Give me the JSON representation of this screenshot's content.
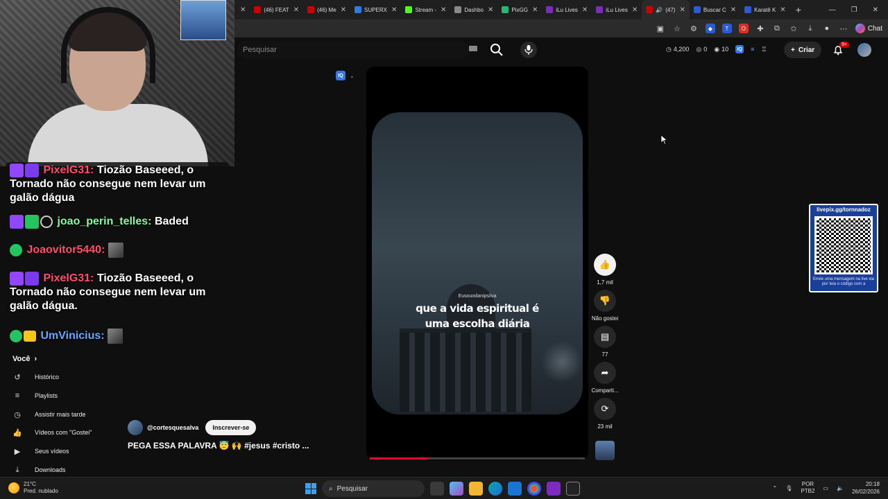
{
  "browser": {
    "tabs": [
      {
        "label": "(46) FEAT",
        "color": "#cc0000"
      },
      {
        "label": "(46) Me",
        "color": "#cc0000"
      },
      {
        "label": "SUPERX",
        "color": "#2a7de1"
      },
      {
        "label": "Stream -",
        "color": "#53fc18"
      },
      {
        "label": "Dashbo",
        "color": "#888888"
      },
      {
        "label": "PixGG",
        "color": "#2bb673"
      },
      {
        "label": "iLu Lives",
        "color": "#7b2cbf"
      },
      {
        "label": "iLu Lives",
        "color": "#7b2cbf"
      },
      {
        "label": "(47)",
        "color": "#cc0000"
      },
      {
        "label": "Buscar C",
        "color": "#2a5bd7"
      },
      {
        "label": "Karatê K",
        "color": "#2a5bd7"
      }
    ],
    "active_tab_index": 8,
    "toolbar_chat_label": "Chat"
  },
  "youtube": {
    "search_placeholder": "Pesquisar",
    "stats": {
      "viewers": "4,200",
      "eye_count": "0",
      "other_count": "10"
    },
    "create_label": "Criar",
    "notification_badge": "9+"
  },
  "chat": {
    "messages": [
      {
        "user": "PixelG31:",
        "text": " Tiozão Baseeed, o Tornado não consegue nem levar um galão dágua"
      },
      {
        "user": "joao_perin_telles:",
        "text": " Baded"
      },
      {
        "user": "Joaovitor5440:",
        "text": ""
      },
      {
        "user": "PixelG31:",
        "text": " Tiozão Baseeed, o Tornado não consegue nem levar um galão dágua."
      },
      {
        "user": "UmVinicius:",
        "text": ""
      }
    ]
  },
  "sidebar": {
    "section": "Você",
    "items": [
      {
        "label": "Histórico",
        "icon": "history-icon"
      },
      {
        "label": "Playlists",
        "icon": "playlist-icon"
      },
      {
        "label": "Assistir mais tarde",
        "icon": "clock-icon"
      },
      {
        "label": "Vídeos com \"Gostei\"",
        "icon": "thumbs-up-icon"
      },
      {
        "label": "Seus vídeos",
        "icon": "play-icon"
      },
      {
        "label": "Downloads",
        "icon": "download-icon"
      }
    ]
  },
  "short": {
    "watermark": "Eusouodanipsilva",
    "caption": "que a vida espiritual é uma escolha diária",
    "progress_fraction": 0.27,
    "actions": {
      "likes": "1,7 mil",
      "dislike_label": "Não gostei",
      "comments": "77",
      "share_label": "Comparti...",
      "remix_count": "23 mil"
    },
    "channel": "@cortesquesalva",
    "subscribe_label": "Inscrever-se",
    "title": "PEGA ESSA PALAVRA 😇 🙌 #jesus #cristo ..."
  },
  "qr": {
    "url": "livepix.gg/tornnadoz",
    "bottom_text": "Envie uma mensagem na live via pix! leia o código com a"
  },
  "taskbar": {
    "temp": "21°C",
    "weather": "Pred. nublado",
    "search_label": "Pesquisar",
    "lang_top": "POR",
    "lang_bottom": "PTB2",
    "time": "20:18",
    "date": "26/02/2026"
  }
}
